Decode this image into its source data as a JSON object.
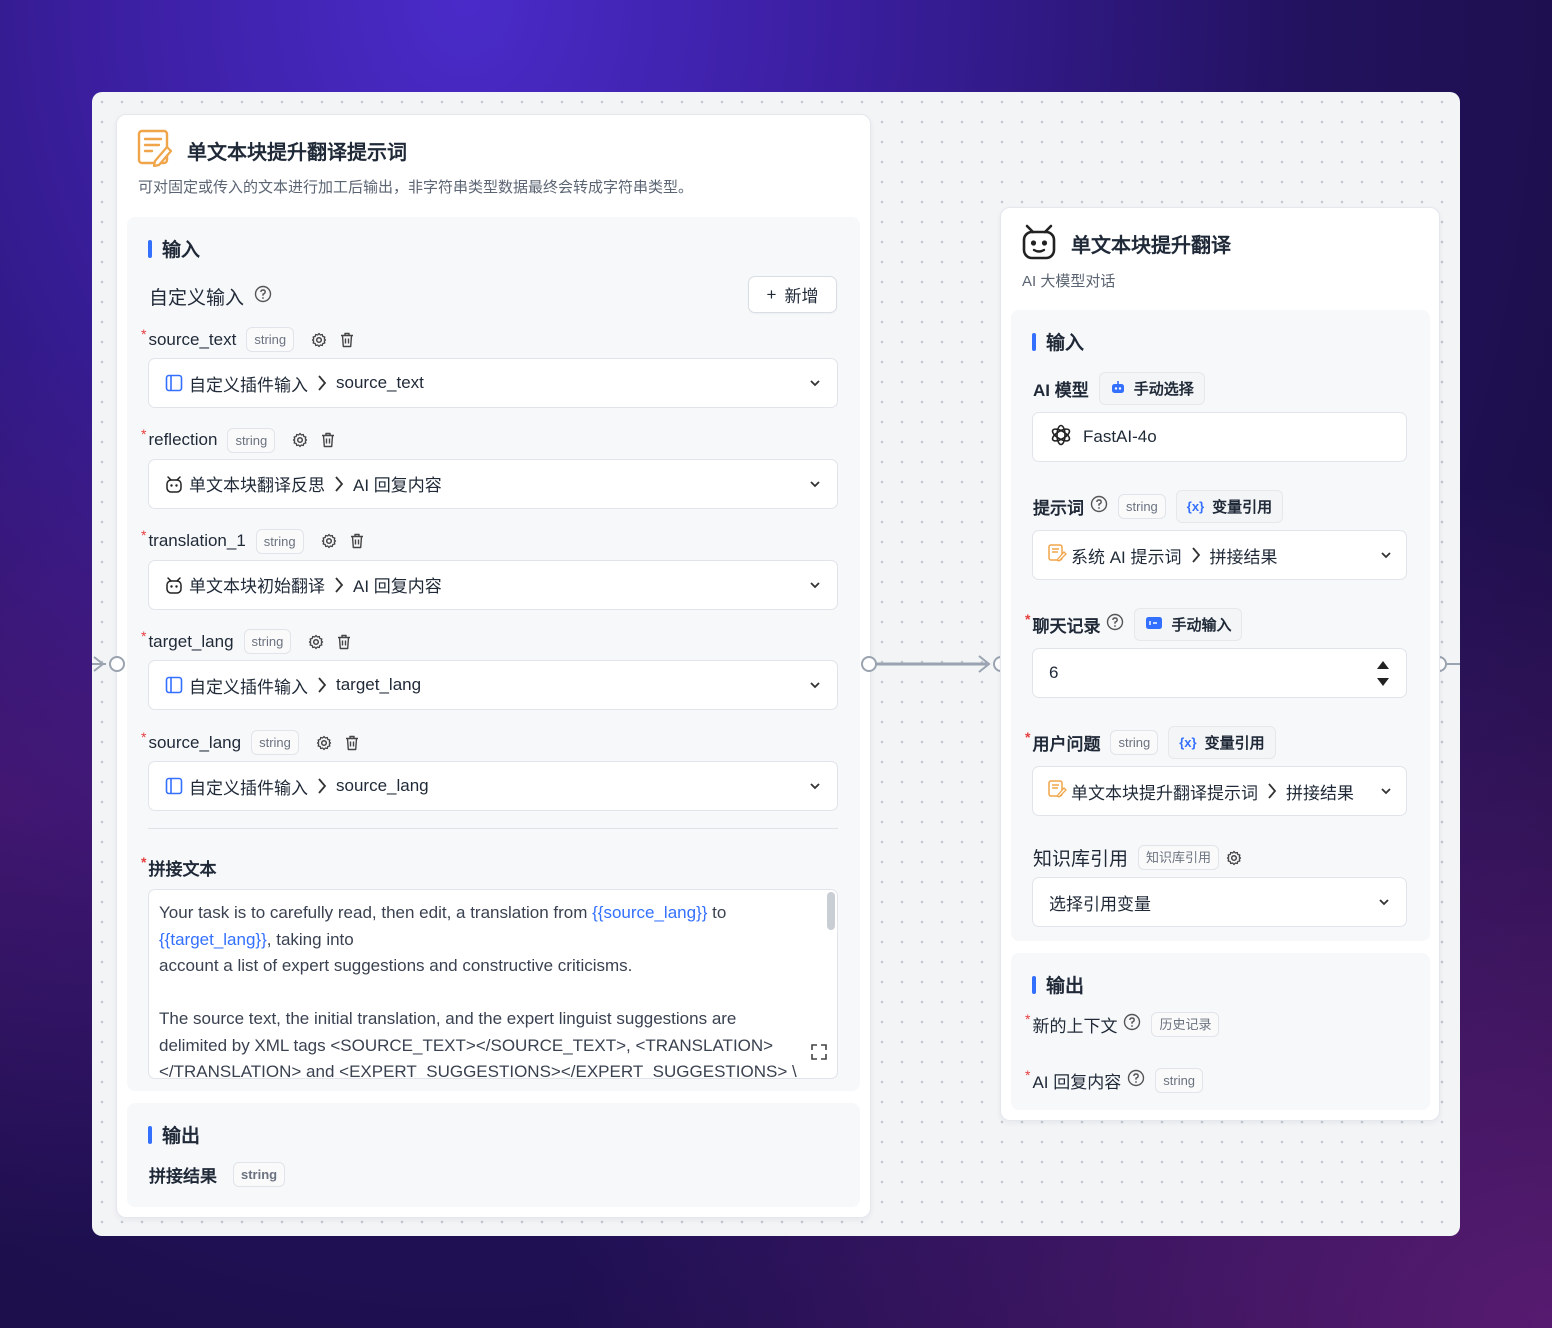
{
  "left_node": {
    "title": "单文本块提升翻译提示词",
    "description": "可对固定或传入的文本进行加工后输出，非字符串类型数据最终会转成字符串类型。",
    "input_section": {
      "title": "输入",
      "custom_input_label": "自定义输入",
      "add_button": "新增",
      "fields": [
        {
          "name": "source_text",
          "type": "string",
          "source": "自定义插件输入",
          "value": "source_text",
          "icon": "plugin-input-icon"
        },
        {
          "name": "reflection",
          "type": "string",
          "source": "单文本块翻译反思",
          "value": "AI 回复内容",
          "icon": "ai-robot-icon"
        },
        {
          "name": "translation_1",
          "type": "string",
          "source": "单文本块初始翻译",
          "value": "AI 回复内容",
          "icon": "ai-robot-icon"
        },
        {
          "name": "target_lang",
          "type": "string",
          "source": "自定义插件输入",
          "value": "target_lang",
          "icon": "plugin-input-icon"
        },
        {
          "name": "source_lang",
          "type": "string",
          "source": "自定义插件输入",
          "value": "source_lang",
          "icon": "plugin-input-icon"
        }
      ],
      "concat_label": "拼接文本",
      "concat_text": {
        "l1a": "Your task is to carefully read, then edit, a translation from ",
        "l1var": "{{source_lang}}",
        "l1b": " to",
        "l2var": "{{target_lang}}",
        "l2b": ", taking into",
        "l3": "account a list of expert suggestions and constructive criticisms.",
        "l5": "The source text, the initial translation, and the expert linguist suggestions are",
        "l6": "delimited by XML tags <SOURCE_TEXT></SOURCE_TEXT>, <TRANSLATION>",
        "l7": "</TRANSLATION> and <EXPERT_SUGGESTIONS></EXPERT_SUGGESTIONS> \\"
      }
    },
    "output_section": {
      "title": "输出",
      "output_name": "拼接结果",
      "output_type": "string"
    }
  },
  "right_node": {
    "title": "单文本块提升翻译",
    "description": "AI 大模型对话",
    "input_section": {
      "title": "输入",
      "ai_model_label": "AI 模型",
      "ai_model_mode": "手动选择",
      "ai_model_value": "FastAI-4o",
      "prompt_label": "提示词",
      "prompt_type": "string",
      "prompt_mode": "变量引用",
      "prompt_source": "系统 AI 提示词",
      "prompt_value": "拼接结果",
      "history_label": "聊天记录",
      "history_mode": "手动输入",
      "history_value": "6",
      "question_label": "用户问题",
      "question_type": "string",
      "question_mode": "变量引用",
      "question_source": "单文本块提升翻译提示词",
      "question_value": "拼接结果",
      "kb_label": "知识库引用",
      "kb_tag": "知识库引用",
      "kb_placeholder": "选择引用变量"
    },
    "output_section": {
      "title": "输出",
      "outputs": [
        {
          "name": "新的上下文",
          "type": "历史记录"
        },
        {
          "name": "AI 回复内容",
          "type": "string"
        }
      ]
    }
  },
  "colors": {
    "accent": "#3370ff",
    "required": "#e53e3e",
    "prompt_icon": "#f0a54a"
  }
}
